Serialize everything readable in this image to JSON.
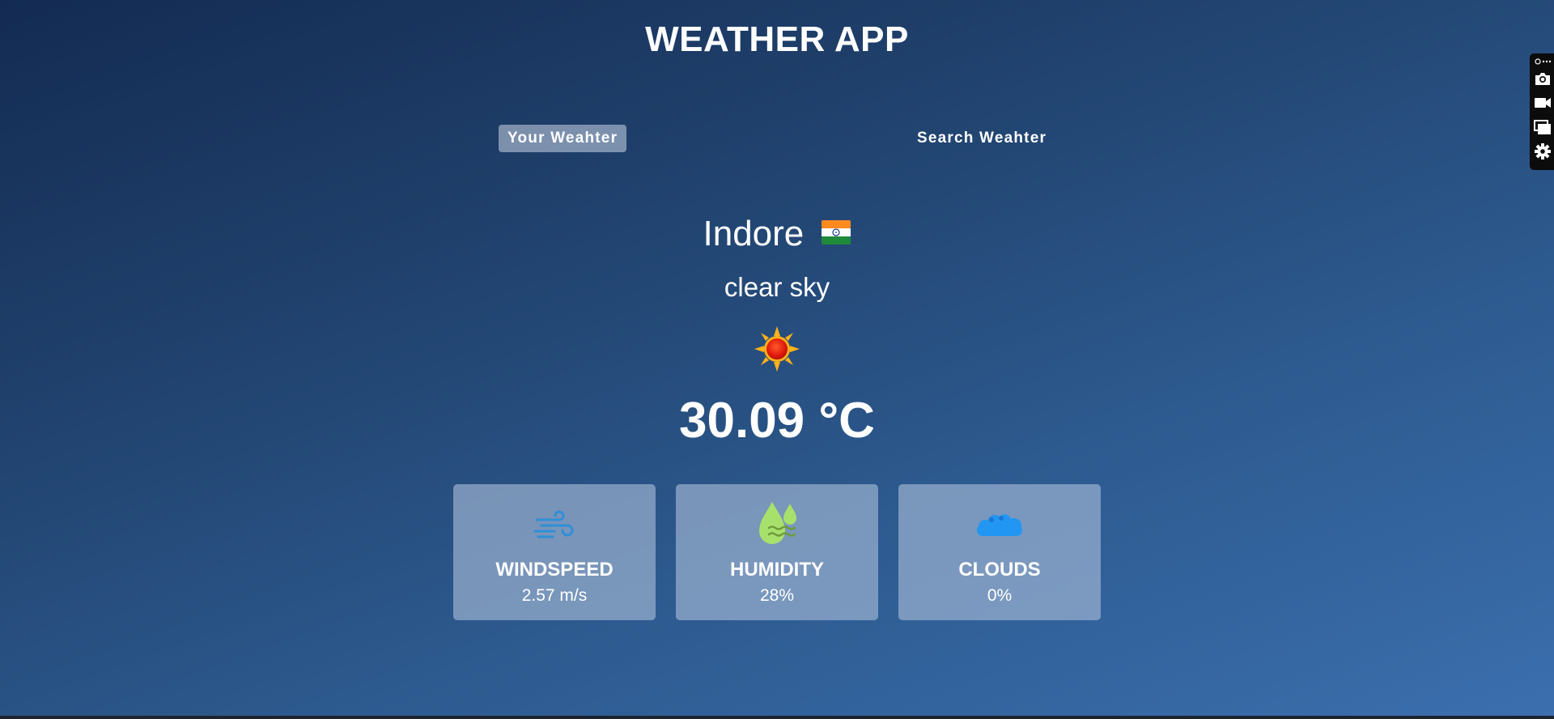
{
  "app": {
    "title": "WEATHER APP"
  },
  "tabs": [
    {
      "label": "Your Weahter",
      "active": true
    },
    {
      "label": "Search Weahter",
      "active": false
    }
  ],
  "weather": {
    "city": "Indore",
    "country_flag_icon": "india-flag-icon",
    "description": "clear sky",
    "condition_icon": "sun-icon",
    "temperature": "30.09 °C"
  },
  "stats": [
    {
      "icon": "wind-icon",
      "title": "WINDSPEED",
      "value": "2.57 m/s"
    },
    {
      "icon": "humidity-icon",
      "title": "HUMIDITY",
      "value": "28%"
    },
    {
      "icon": "cloud-icon",
      "title": "CLOUDS",
      "value": "0%"
    }
  ],
  "extension_toolbar": {
    "icons": [
      "more-icon",
      "camera-icon",
      "video-icon",
      "window-icon",
      "gear-icon"
    ]
  },
  "colors": {
    "background_top": "#132b52",
    "background_bottom": "#3b6fae",
    "card_bg": "#aabdd8",
    "wind_blue": "#2f8fd8",
    "humidity_green": "#a8e06c",
    "cloud_blue": "#2196f3"
  }
}
